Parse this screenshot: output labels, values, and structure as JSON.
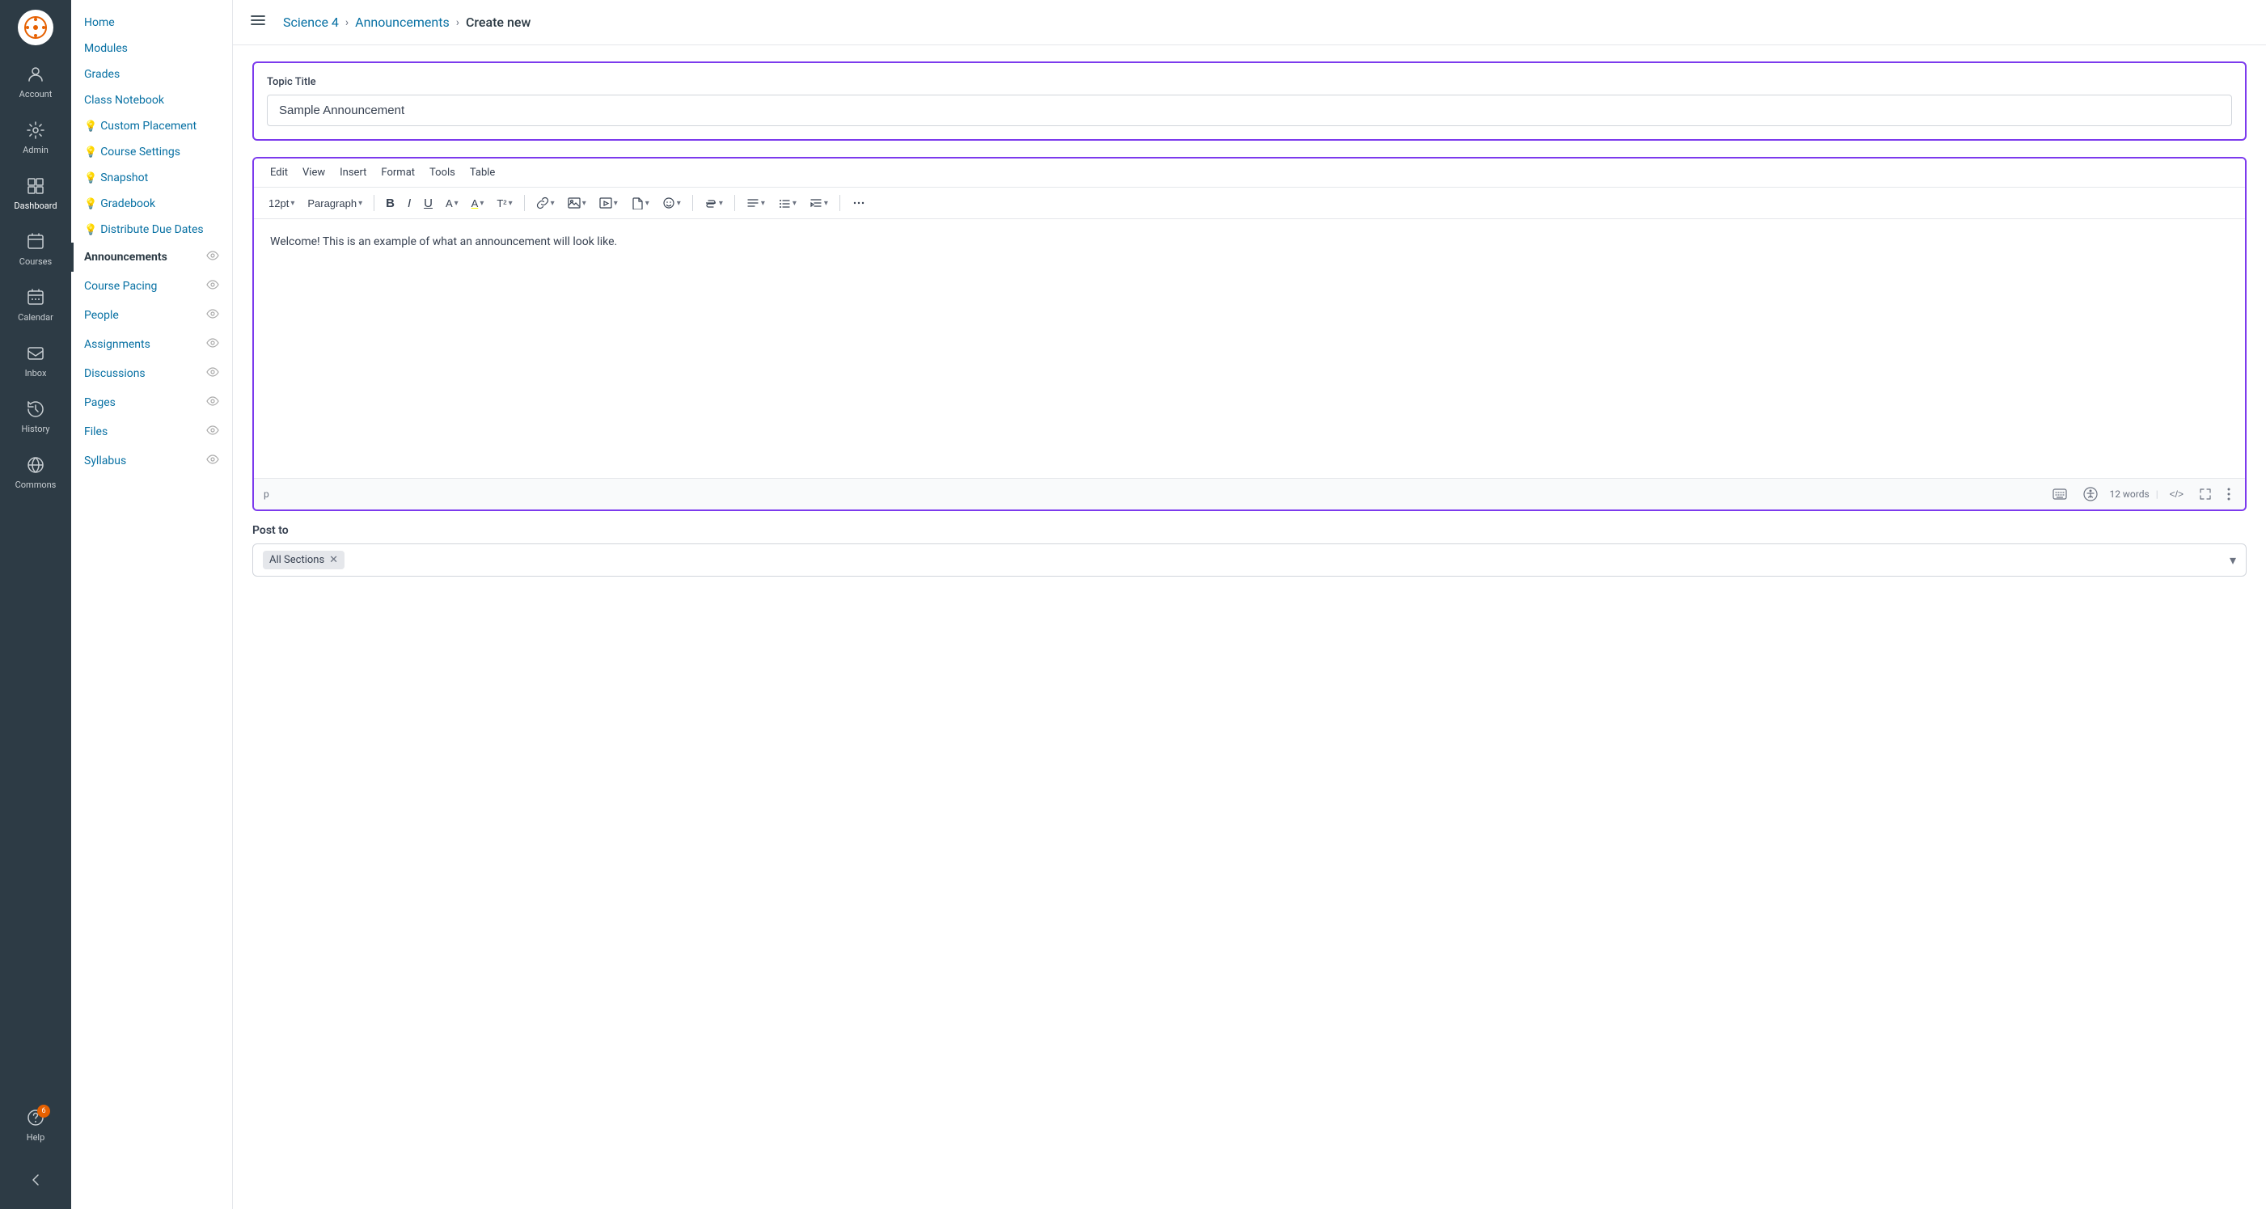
{
  "global_sidebar": {
    "items": [
      {
        "id": "account",
        "label": "Account",
        "icon": "👤"
      },
      {
        "id": "admin",
        "label": "Admin",
        "icon": "⚙"
      },
      {
        "id": "dashboard",
        "label": "Dashboard",
        "icon": "🏠"
      },
      {
        "id": "courses",
        "label": "Courses",
        "icon": "📚"
      },
      {
        "id": "calendar",
        "label": "Calendar",
        "icon": "📅"
      },
      {
        "id": "inbox",
        "label": "Inbox",
        "icon": "✉"
      },
      {
        "id": "history",
        "label": "History",
        "icon": "↩"
      },
      {
        "id": "commons",
        "label": "Commons",
        "icon": "↗"
      },
      {
        "id": "help",
        "label": "Help",
        "icon": "?",
        "badge": "6"
      }
    ]
  },
  "course_sidebar": {
    "items": [
      {
        "id": "home",
        "label": "Home",
        "icon": "",
        "has_eye": false
      },
      {
        "id": "modules",
        "label": "Modules",
        "icon": "",
        "has_eye": false
      },
      {
        "id": "grades",
        "label": "Grades",
        "icon": "",
        "has_eye": false
      },
      {
        "id": "class-notebook",
        "label": "Class Notebook",
        "icon": "",
        "has_eye": false
      },
      {
        "id": "custom-placement",
        "label": "Custom Placement",
        "icon": "💡",
        "has_eye": false
      },
      {
        "id": "course-settings",
        "label": "Course Settings",
        "icon": "💡",
        "has_eye": false
      },
      {
        "id": "snapshot",
        "label": "Snapshot",
        "icon": "💡",
        "has_eye": false
      },
      {
        "id": "gradebook",
        "label": "Gradebook",
        "icon": "💡",
        "has_eye": false
      },
      {
        "id": "distribute-due-dates",
        "label": "Distribute Due Dates",
        "icon": "💡",
        "has_eye": false
      },
      {
        "id": "announcements",
        "label": "Announcements",
        "icon": "",
        "has_eye": true,
        "active": true
      },
      {
        "id": "course-pacing",
        "label": "Course Pacing",
        "icon": "",
        "has_eye": true
      },
      {
        "id": "people",
        "label": "People",
        "icon": "",
        "has_eye": true
      },
      {
        "id": "assignments",
        "label": "Assignments",
        "icon": "",
        "has_eye": true
      },
      {
        "id": "discussions",
        "label": "Discussions",
        "icon": "",
        "has_eye": true
      },
      {
        "id": "pages",
        "label": "Pages",
        "icon": "",
        "has_eye": true
      },
      {
        "id": "files",
        "label": "Files",
        "icon": "",
        "has_eye": true
      },
      {
        "id": "syllabus",
        "label": "Syllabus",
        "icon": "",
        "has_eye": true
      }
    ]
  },
  "topbar": {
    "menu_label": "☰",
    "breadcrumb": [
      {
        "label": "Science 4",
        "link": true
      },
      {
        "label": "Announcements",
        "link": true
      },
      {
        "label": "Create new",
        "link": false
      }
    ]
  },
  "editor": {
    "topic_title_label": "Topic Title",
    "topic_title_value": "Sample Announcement",
    "topic_title_placeholder": "Topic Title",
    "menubar": [
      "Edit",
      "View",
      "Insert",
      "Format",
      "Tools",
      "Table"
    ],
    "toolbar_font_size": "12pt",
    "toolbar_paragraph": "Paragraph",
    "content": "Welcome! This is an example of what an announcement will look like.",
    "footer_tag": "p",
    "footer_word_count": "12 words"
  },
  "post_to": {
    "label": "Post to",
    "tag": "All Sections",
    "placeholder": ""
  }
}
